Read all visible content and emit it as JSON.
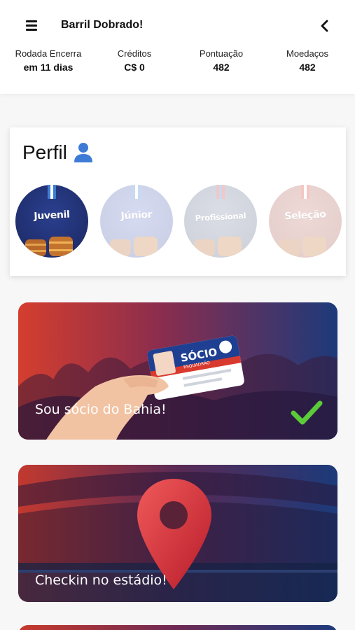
{
  "header": {
    "title": "Barril Dobrado!",
    "icons": {
      "menu": "hamburger-menu-icon",
      "back": "chevron-left-icon"
    }
  },
  "stats": [
    {
      "label": "Rodada Encerra",
      "value": "em 11 dias"
    },
    {
      "label": "Créditos",
      "value": "C$ 0"
    },
    {
      "label": "Pontuação",
      "value": "482"
    },
    {
      "label": "Moedaços",
      "value": "482"
    }
  ],
  "profile": {
    "title": "Perfil",
    "icon": "user-icon",
    "levels": [
      {
        "label": "Juvenil",
        "active": true
      },
      {
        "label": "Júnior",
        "active": false
      },
      {
        "label": "Profissional",
        "active": false
      },
      {
        "label": "Seleção",
        "active": false
      }
    ]
  },
  "actions": {
    "socio": {
      "label": "Sou sócio do Bahia!",
      "card_title": "SÓCIO",
      "card_subtitle": "ESQUADRÃO",
      "completed": true
    },
    "checkin": {
      "label": "Checkin no estádio!"
    }
  },
  "colors": {
    "brand_red": "#d93a2f",
    "brand_blue": "#1d3b7c",
    "check_green": "#5ccb3a",
    "user_icon_blue": "#3d7bd6"
  }
}
